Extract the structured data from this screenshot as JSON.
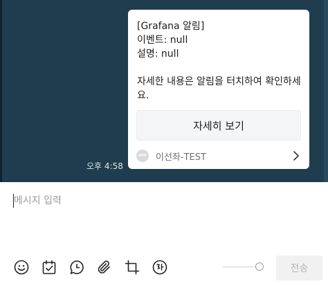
{
  "message": {
    "time": "오후 4:58",
    "card": {
      "lines": [
        "[Grafana 알림]",
        "이벤트: null",
        "설명: null"
      ],
      "body": "자세한 내용은 알림을 터치하여 확인하세요.",
      "button_label": "자세히 보기",
      "app_icon_label": "APP",
      "sender": "이선좌-TEST"
    }
  },
  "composer": {
    "placeholder": "메시지 입력",
    "send_label": "전송",
    "toolbar_icons": [
      "emoji-icon",
      "calendar-check-icon",
      "speech-bubble-icon",
      "paperclip-icon",
      "crop-icon",
      "translate-icon"
    ],
    "opacity_slider_level": 1.0
  }
}
